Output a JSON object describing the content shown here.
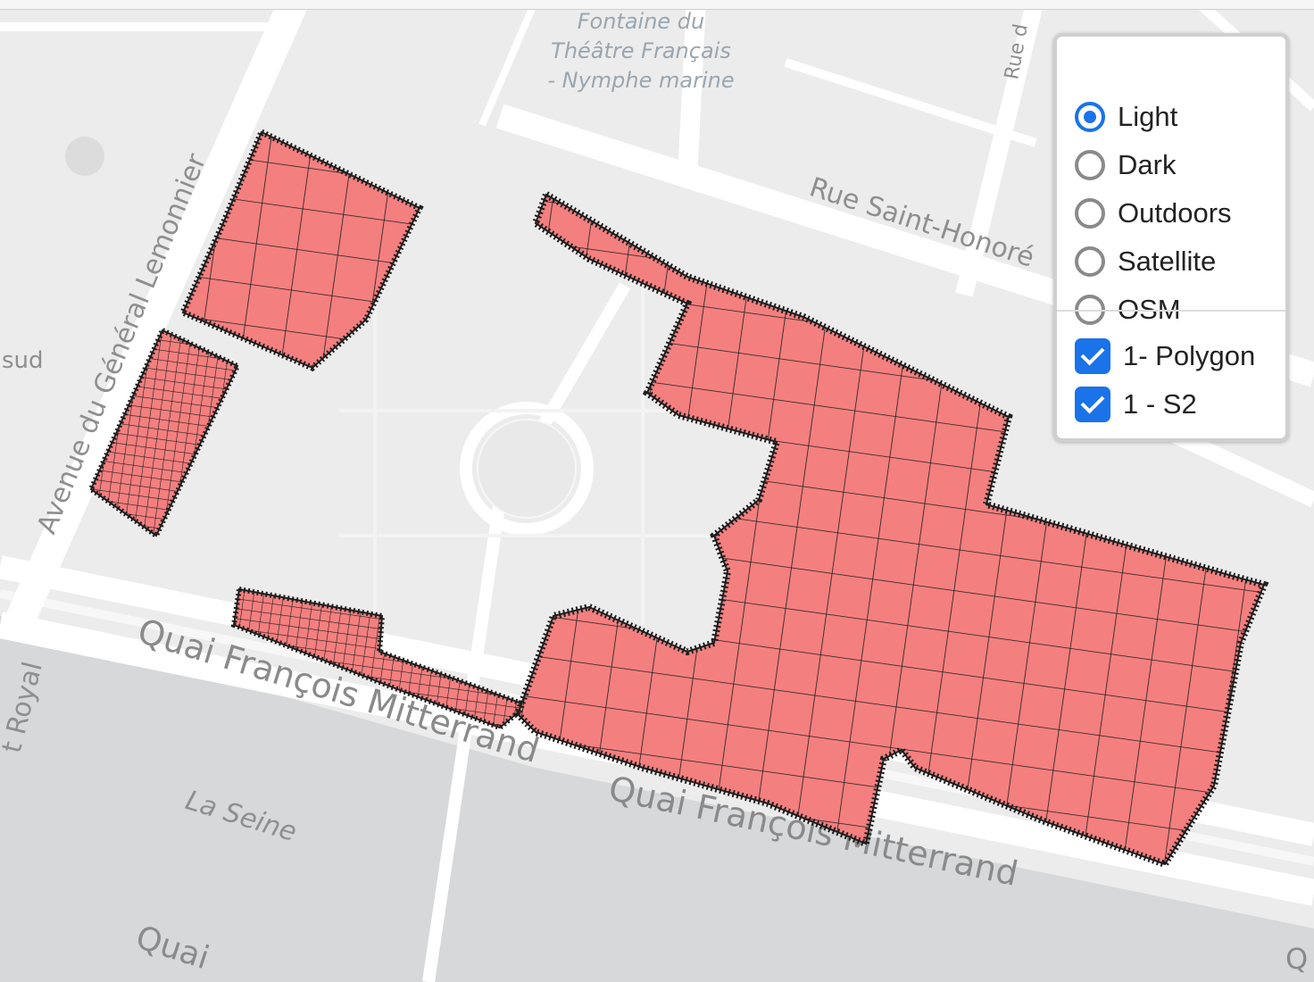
{
  "map": {
    "labels": {
      "fontaine_line1": "Fontaine du",
      "fontaine_line2": "Théâtre Français",
      "fontaine_line3": "- Nymphe marine",
      "rue_saint_honore": "Rue Saint-Honoré",
      "avenue_lemonnier": "Avenue du Général Lemonnier",
      "quai_mitterrand_1": "Quai François Mitterrand",
      "quai_mitterrand_2": "Quai François Mitterrand",
      "la_seine": "La Seine",
      "sud": "sud",
      "royal": "t Royal",
      "rue_top": "Rue d",
      "quai_bottom": "Quai",
      "q_right": "Q"
    },
    "overlay_color": "#f47f7f",
    "overlay_stroke": "#1e1e1e"
  },
  "layer_control": {
    "base_layers": [
      {
        "label": "Light",
        "selected": true
      },
      {
        "label": "Dark",
        "selected": false
      },
      {
        "label": "Outdoors",
        "selected": false
      },
      {
        "label": "Satellite",
        "selected": false
      },
      {
        "label": "OSM",
        "selected": false
      }
    ],
    "overlays": [
      {
        "label": "1- Polygon",
        "checked": true
      },
      {
        "label": "1 - S2",
        "checked": true
      }
    ],
    "accent_color": "#1a73e8"
  }
}
